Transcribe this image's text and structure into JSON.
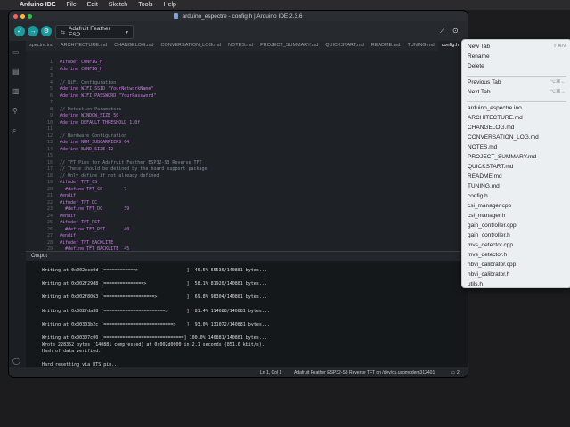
{
  "menubar": {
    "app": "Arduino IDE",
    "items": [
      "File",
      "Edit",
      "Sketch",
      "Tools",
      "Help"
    ]
  },
  "window": {
    "title": "arduino_espectre - config.h | Arduino IDE 2.3.6"
  },
  "toolbar": {
    "verify_icon": "check-icon",
    "upload_icon": "arrow-right-icon",
    "debug_icon": "debug-icon",
    "board": "Adafruit Feather ESP..."
  },
  "tabs": [
    {
      "label": "spectre.ino",
      "active": false
    },
    {
      "label": "ARCHITECTURE.md",
      "active": false
    },
    {
      "label": "CHANGELOG.md",
      "active": false
    },
    {
      "label": "CONVERSATION_LOG.md",
      "active": false
    },
    {
      "label": "NOTES.md",
      "active": false
    },
    {
      "label": "PROJECT_SUMMARY.md",
      "active": false
    },
    {
      "label": "QUICKSTART.md",
      "active": false
    },
    {
      "label": "README.md",
      "active": false
    },
    {
      "label": "TUNING.md",
      "active": false
    },
    {
      "label": "config.h",
      "active": true
    }
  ],
  "tabs_more": "···",
  "code_lines": [
    {
      "n": "1",
      "t": "#ifndef CONFIG_H"
    },
    {
      "n": "2",
      "t": "#define CONFIG_H"
    },
    {
      "n": "3",
      "t": ""
    },
    {
      "n": "4",
      "t": "// WiFi Configuration"
    },
    {
      "n": "5",
      "t": "#define WIFI_SSID \"YourNetworkName\""
    },
    {
      "n": "6",
      "t": "#define WIFI_PASSWORD \"YourPassword\""
    },
    {
      "n": "7",
      "t": ""
    },
    {
      "n": "8",
      "t": "// Detection Parameters"
    },
    {
      "n": "9",
      "t": "#define WINDOW_SIZE 50"
    },
    {
      "n": "10",
      "t": "#define DEFAULT_THRESHOLD 1.0f"
    },
    {
      "n": "11",
      "t": ""
    },
    {
      "n": "12",
      "t": "// Hardware Configuration"
    },
    {
      "n": "13",
      "t": "#define NUM_SUBCARRIERS 64"
    },
    {
      "n": "14",
      "t": "#define BAND_SIZE 12"
    },
    {
      "n": "15",
      "t": ""
    },
    {
      "n": "16",
      "t": "// TFT Pins for Adafruit Feather ESP32-S3 Reverse TFT"
    },
    {
      "n": "17",
      "t": "// These should be defined by the board support package"
    },
    {
      "n": "18",
      "t": "// Only define if not already defined"
    },
    {
      "n": "19",
      "t": "#ifndef TFT_CS"
    },
    {
      "n": "20",
      "t": "  #define TFT_CS        7"
    },
    {
      "n": "21",
      "t": "#endif"
    },
    {
      "n": "22",
      "t": "#ifndef TFT_DC"
    },
    {
      "n": "23",
      "t": "  #define TFT_DC        39"
    },
    {
      "n": "24",
      "t": "#endif"
    },
    {
      "n": "25",
      "t": "#ifndef TFT_RST"
    },
    {
      "n": "26",
      "t": "  #define TFT_RST       40"
    },
    {
      "n": "27",
      "t": "#endif"
    },
    {
      "n": "28",
      "t": "#ifndef TFT_BACKLITE"
    },
    {
      "n": "29",
      "t": "  #define TFT_BACKLITE  45"
    }
  ],
  "output": {
    "header": "Output",
    "lines": [
      "Writing at 0x002ece0d [============>                  ]  46.5% 65536/140881 bytes...",
      "",
      "Writing at 0x002f29d8 [===============>               ]  58.1% 81920/140881 bytes...",
      "",
      "Writing at 0x002f8063 [===================>           ]  69.8% 98304/140881 bytes...",
      "",
      "Writing at 0x002fda38 [=======================>       ]  81.4% 114688/140881 bytes...",
      "",
      "Writing at 0x00303b2c [==========================>    ]  93.0% 131072/140881 bytes...",
      "",
      "Writing at 0x00307c00 [==============================] 100.0% 140881/140881 bytes...",
      "Wrote 228352 bytes (140881 compressed) at 0x002d0000 in 2.1 seconds (851.6 kbit/s).",
      "Hash of data verified.",
      "",
      "Hard resetting via RTS pin..."
    ]
  },
  "statusbar": {
    "position": "Ln 1, Col 1",
    "board": "Adafruit Feather ESP32-S3 Reverse TFT on /dev/cu.usbmodem312401",
    "notifications": "2"
  },
  "context_menu": {
    "top": [
      {
        "label": "New Tab",
        "shortcut": "⇧⌘N"
      },
      {
        "label": "Rename",
        "shortcut": ""
      },
      {
        "label": "Delete",
        "shortcut": ""
      }
    ],
    "nav": [
      {
        "label": "Previous Tab",
        "shortcut": "⌥⌘←"
      },
      {
        "label": "Next Tab",
        "shortcut": "⌥⌘→"
      }
    ],
    "files": [
      "arduino_espectre.ino",
      "ARCHITECTURE.md",
      "CHANGELOG.md",
      "CONVERSATION_LOG.md",
      "NOTES.md",
      "PROJECT_SUMMARY.md",
      "QUICKSTART.md",
      "README.md",
      "TUNING.md",
      "config.h",
      "csi_manager.cpp",
      "csi_manager.h",
      "gain_controller.cpp",
      "gain_controller.h",
      "mvs_detector.cpp",
      "mvs_detector.h",
      "nbvi_calibrator.cpp",
      "nbvi_calibrator.h",
      "utils.h"
    ]
  },
  "colors": {
    "accent": "#1a9a9d",
    "editor_bg": "#1e2227",
    "keyword": "#c678dd",
    "comment": "#7f8a96",
    "string": "#98c379",
    "number": "#d19a66"
  }
}
